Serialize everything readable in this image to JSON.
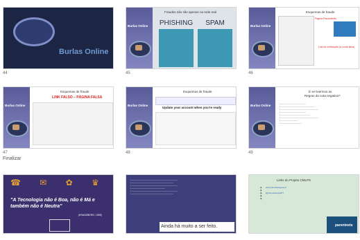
{
  "slides": [
    {
      "num": "44",
      "title": "Burlas Online"
    },
    {
      "num": "45",
      "banner": "Burlas Online",
      "subtitle": "Fraudes não são apenas na rede real",
      "phishing": "PHISHING",
      "spam": "SPAM"
    },
    {
      "num": "46",
      "banner": "Burlas Online",
      "title": "Esquemas de fraude",
      "red_1": "Página Fraudulenta",
      "red_2": "Link de verificação (à conta falsa)"
    },
    {
      "num": "47",
      "banner": "Burlas Online",
      "title": "Esquemas de fraude",
      "subtitle": "LINK FALSO – PÁGINA FALSA"
    },
    {
      "num": "48",
      "banner": "Burlas Online",
      "title": "Esquemas de fraude",
      "subtitle": "Update your account when you're ready"
    },
    {
      "num": "49",
      "banner": "Burlas Online",
      "title": "E se tivermos as",
      "title2": "Regras da nota negativa?"
    },
    {
      "num": "",
      "quote": "\"A Tecnologia não é Boa, não é Má e também não é Neutra\"",
      "author": "(KRANZBERG, 1985)"
    },
    {
      "num": "",
      "closing": "Ainda há muito a ser feito."
    },
    {
      "num": "",
      "title": "Links do Projeto CMLPS",
      "link_1": "www.internetsegura.pt",
      "link_2": "@internetseguraPT",
      "parentnets": "parentnets"
    }
  ],
  "section_label": "Finalizar"
}
